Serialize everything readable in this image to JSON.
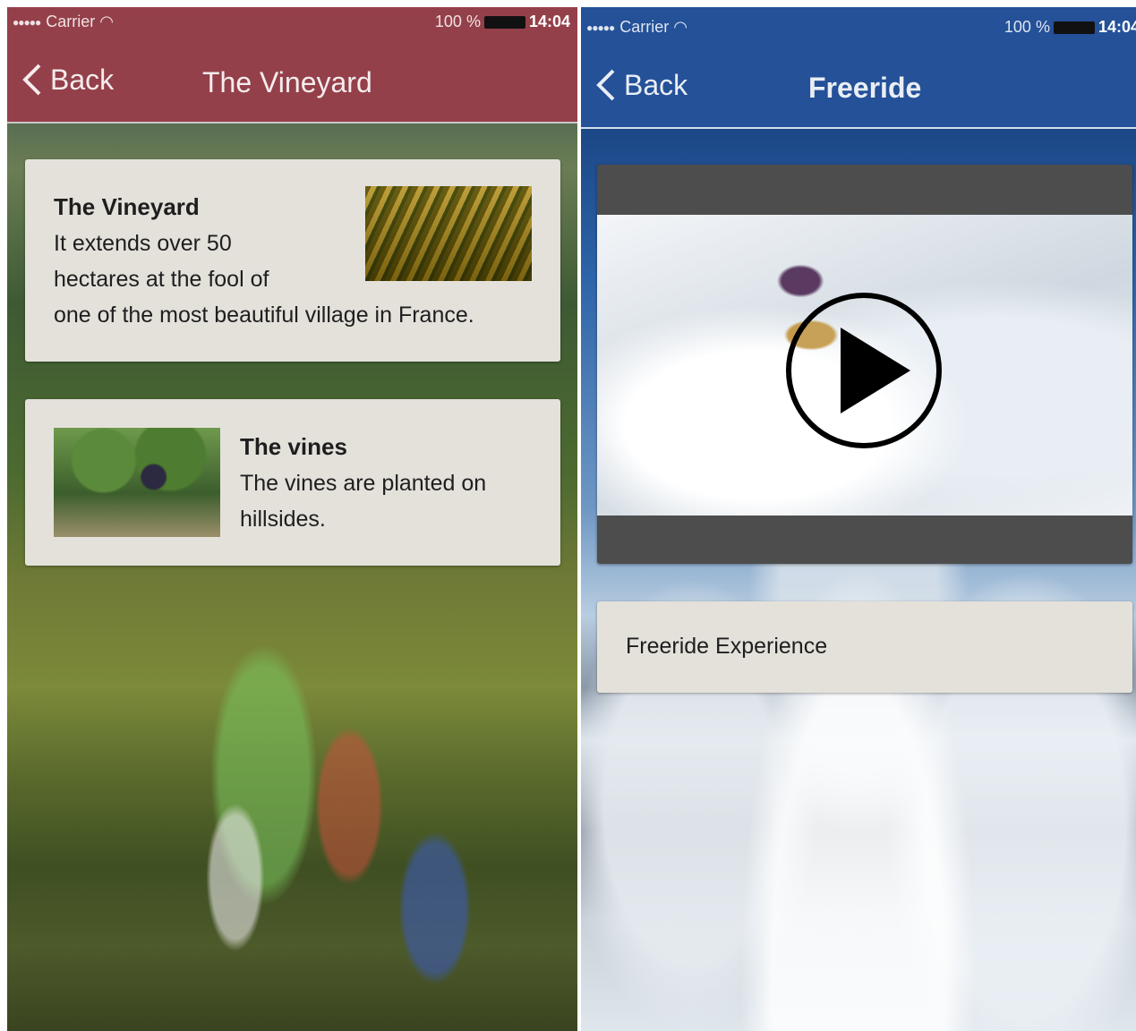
{
  "left_screen": {
    "status": {
      "carrier": "Carrier",
      "battery": "100 %",
      "time": "14:04"
    },
    "nav": {
      "back_label": "Back",
      "title": "The Vineyard",
      "bar_color": "#94404a"
    },
    "cards": [
      {
        "title": "The Vineyard",
        "lines": [
          "It extends over 50",
          "hectares at the fool of",
          "one of the most beautiful village in France."
        ]
      },
      {
        "title": "The vines",
        "lines": [
          "The vines are planted on",
          "hillsides."
        ]
      }
    ]
  },
  "right_screen": {
    "status": {
      "carrier": "Carrier",
      "battery": "100 %",
      "time": "14:04"
    },
    "nav": {
      "back_label": "Back",
      "title": "Freeride",
      "bar_color": "#245198"
    },
    "video": {
      "icon": "play-icon"
    },
    "card": {
      "label": "Freeride Experience"
    }
  }
}
